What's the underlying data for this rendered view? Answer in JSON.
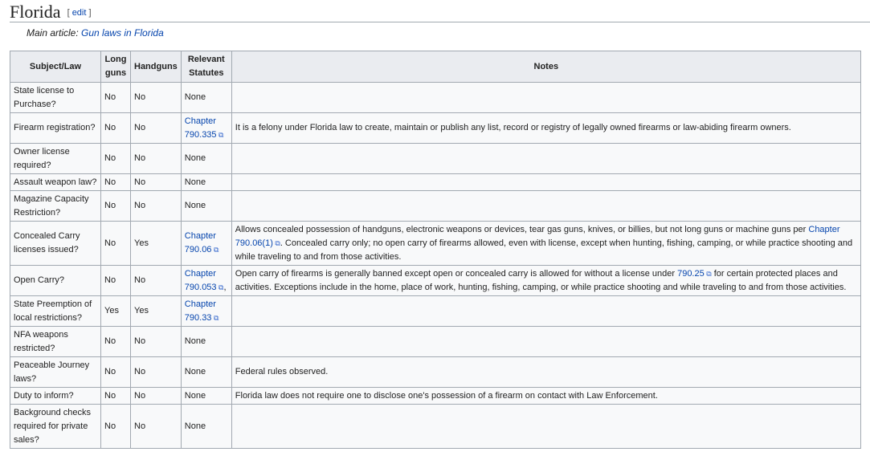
{
  "heading": {
    "title": "Florida",
    "edit_open": "[",
    "edit": "edit",
    "edit_close": "]"
  },
  "hatnote": {
    "prefix": "Main article: ",
    "link": "Gun laws in Florida"
  },
  "table": {
    "headers": [
      "Subject/Law",
      "Long guns",
      "Handguns",
      "Relevant Statutes",
      "Notes"
    ],
    "rows": [
      {
        "subject": "State license to Purchase?",
        "long": "No",
        "hand": "No",
        "statute": [
          {
            "t": "None"
          }
        ],
        "notes": [],
        "h": 38
      },
      {
        "subject": "Firearm registration?",
        "long": "No",
        "hand": "No",
        "statute": [
          {
            "t": "Chapter 790.335",
            "link": true
          }
        ],
        "notes": [
          {
            "t": "It is a felony under Florida law to create, maintain or publish any list, record or registry of legally owned firearms or law-abiding firearm owners."
          }
        ],
        "h": 38
      },
      {
        "subject": "Owner license required?",
        "long": "No",
        "hand": "No",
        "statute": [
          {
            "t": "None"
          }
        ],
        "notes": [],
        "h": 38
      },
      {
        "subject": "Assault weapon law?",
        "long": "No",
        "hand": "No",
        "statute": [
          {
            "t": "None"
          }
        ],
        "notes": [],
        "h": 21
      },
      {
        "subject": "Magazine Capacity Restriction?",
        "long": "No",
        "hand": "No",
        "statute": [
          {
            "t": "None"
          }
        ],
        "notes": [],
        "h": 38
      },
      {
        "subject": "Concealed Carry licenses issued?",
        "long": "No",
        "hand": "Yes",
        "statute": [
          {
            "t": "Chapter 790.06",
            "link": true
          }
        ],
        "notes": [
          {
            "t": "Allows concealed possession of handguns, electronic weapons or devices, tear gas guns, knives, or billies, but not long guns or machine guns per "
          },
          {
            "t": "Chapter 790.06(1)",
            "link": true
          },
          {
            "t": ". Concealed carry only; no open carry of firearms allowed, even with license, except when hunting, fishing, camping, or while practice shooting and while traveling to and from those activities."
          }
        ],
        "h": 55
      },
      {
        "subject": "Open Carry?",
        "long": "No",
        "hand": "No",
        "statute": [
          {
            "t": "Chapter 790.053",
            "link": true
          },
          {
            "t": ","
          }
        ],
        "notes": [
          {
            "t": "Open carry of firearms is generally banned except open or concealed carry is allowed for without a license under "
          },
          {
            "t": "790.25",
            "link": true
          },
          {
            "t": " for certain protected places and activities. Exceptions include in the home, place of work, hunting, fishing, camping, or while practice shooting and while traveling to and from those activities."
          }
        ],
        "h": 38
      },
      {
        "subject": "State Preemption of local restrictions?",
        "long": "Yes",
        "hand": "Yes",
        "statute": [
          {
            "t": "Chapter 790.33",
            "link": true
          }
        ],
        "notes": [],
        "h": 38
      },
      {
        "subject": "NFA weapons restricted?",
        "long": "No",
        "hand": "No",
        "statute": [
          {
            "t": "None"
          }
        ],
        "notes": [],
        "h": 38
      },
      {
        "subject": "Peaceable Journey laws?",
        "long": "No",
        "hand": "No",
        "statute": [
          {
            "t": "None"
          }
        ],
        "notes": [
          {
            "t": "Federal rules observed."
          }
        ],
        "h": 38
      },
      {
        "subject": "Duty to inform?",
        "long": "No",
        "hand": "No",
        "statute": [
          {
            "t": "None"
          }
        ],
        "notes": [
          {
            "t": "Florida law does not require one to disclose one's possession of a firearm on contact with Law Enforcement."
          }
        ],
        "h": 21
      },
      {
        "subject": "Background checks required for private sales?",
        "long": "No",
        "hand": "No",
        "statute": [
          {
            "t": "None"
          }
        ],
        "notes": [],
        "h": 55
      }
    ]
  },
  "icons": {
    "external": "external-link-icon"
  }
}
